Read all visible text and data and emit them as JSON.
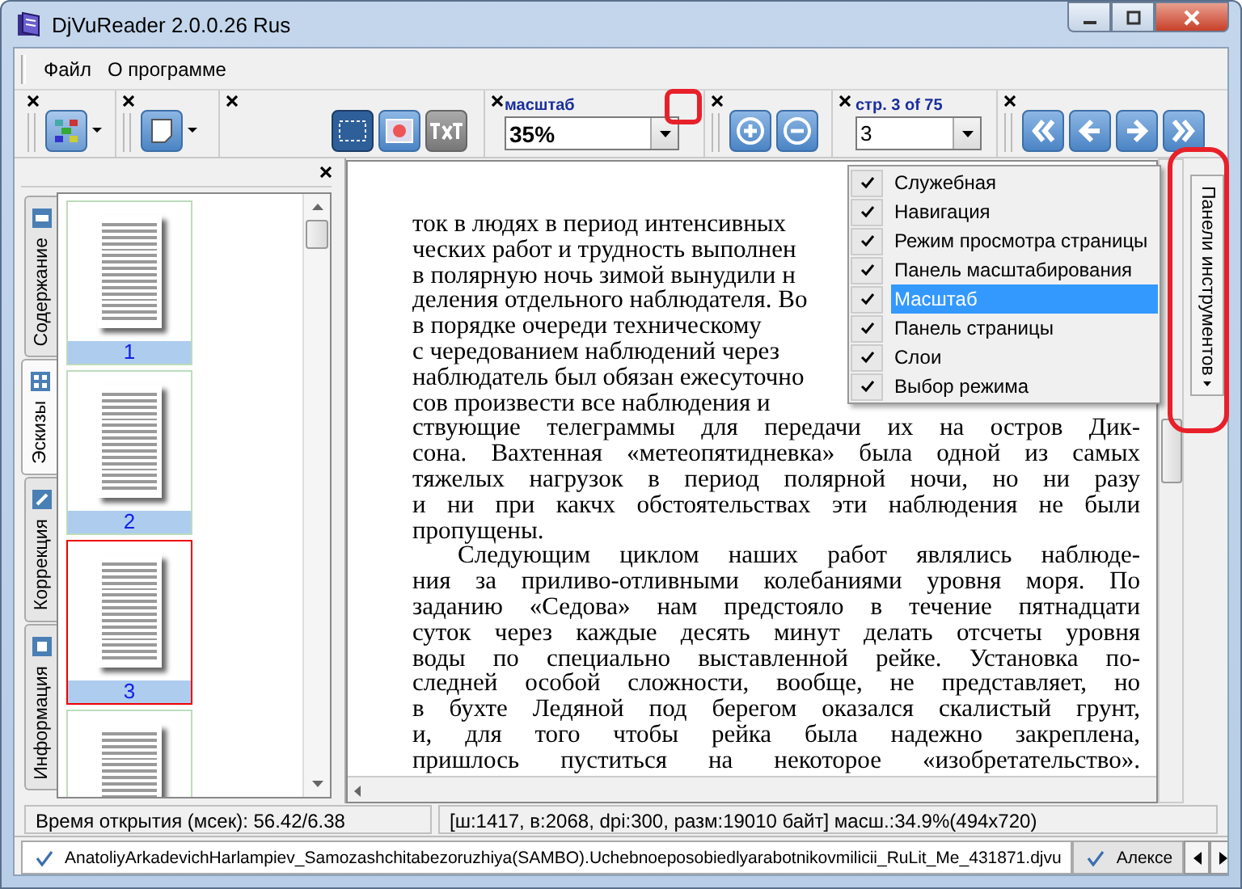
{
  "window": {
    "title": "DjVuReader 2.0.0.26 Rus"
  },
  "menu": [
    "Файл",
    "О программе"
  ],
  "toolbar": {
    "zoom": {
      "label": "масштаб",
      "value": "35%"
    },
    "page": {
      "label": "стр. 3 of 75",
      "value": "3"
    }
  },
  "sidebar": {
    "tabs": [
      {
        "label": "Содержание",
        "selected": false
      },
      {
        "label": "Эскизы",
        "selected": true
      },
      {
        "label": "Коррекция",
        "selected": false
      },
      {
        "label": "Информация",
        "selected": false
      }
    ],
    "thumbnails": [
      {
        "label": "1",
        "selected": false
      },
      {
        "label": "2",
        "selected": false
      },
      {
        "label": "3",
        "selected": true
      },
      {
        "selected": false
      }
    ]
  },
  "document": {
    "lines": [
      {
        "text": "ток в людях в период интенсивных",
        "full": false
      },
      {
        "text": "ческих работ и трудность выполнен",
        "full": false
      },
      {
        "text": "в полярную ночь зимой вынудили н",
        "full": false
      },
      {
        "text": "деления отдельного наблюдателя. Во",
        "full": false
      },
      {
        "text": "в порядке очереди техническому",
        "full": false
      },
      {
        "text": "с чередованием наблюдений через",
        "full": false
      },
      {
        "text": "наблюдатель был обязан ежесуточно",
        "full": false
      },
      {
        "text": "сов произвести все наблюдения и",
        "full": false
      },
      {
        "text": "ствующие телеграммы для передачи их на остров Дик-",
        "full": true
      },
      {
        "text": "сона. Вахтенная «метеопятидневка» была одной из самых",
        "full": true
      },
      {
        "text": "тяжелых нагрузок в период полярной ночи, но ни разу",
        "full": true
      },
      {
        "text": "и ни при какчх обстоятельствах эти наблюдения не были",
        "full": true
      },
      {
        "text": "пропущены.",
        "full": false
      },
      {
        "text": "Следующим циклом наших работ являлись наблюде-",
        "full": true,
        "indent": true
      },
      {
        "text": "ния за приливо-отливными колебаниями уровня моря. По",
        "full": true
      },
      {
        "text": "заданию «Седова» нам предстояло в течение пятнадцати",
        "full": true
      },
      {
        "text": "суток через каждые десять минут делать отсчеты уровня",
        "full": true
      },
      {
        "text": "воды по специально выставленной рейке. Установка по-",
        "full": true
      },
      {
        "text": "следней особой сложности, вообще, не представляет, но",
        "full": true
      },
      {
        "text": "в бухте Ледяной под берегом оказался скалистый грунт,",
        "full": true
      },
      {
        "text": "и, для того чтобы рейка была надежно закреплена,",
        "full": true
      },
      {
        "text": "пришлось пуститься на некоторое «изобретательство».",
        "full": true
      }
    ]
  },
  "popup_menu": {
    "items": [
      {
        "label": "Служебная",
        "checked": true,
        "selected": false
      },
      {
        "label": "Навигация",
        "checked": true,
        "selected": false
      },
      {
        "label": "Режим просмотра страницы",
        "checked": true,
        "selected": false
      },
      {
        "label": "Панель масштабирования",
        "checked": true,
        "selected": false
      },
      {
        "label": "Масштаб",
        "checked": true,
        "selected": true
      },
      {
        "label": "Панель страницы",
        "checked": true,
        "selected": false
      },
      {
        "label": "Слои",
        "checked": true,
        "selected": false
      },
      {
        "label": "Выбор режима",
        "checked": true,
        "selected": false
      }
    ]
  },
  "right_panel": {
    "label": "Панели инструментов"
  },
  "status_bar": [
    "Время открытия (мсек): 56.42/6.38",
    "[ш:1417, в:2068, dpi:300, разм:19010 байт] масш.:34.9%(494x720)"
  ],
  "document_tabs": [
    {
      "label": "AnatoliyArkadevichHarlampiev_Samozashchitabezoruzhiya(SAMBO).Uchebnoeposobiedlyarabotnikovmilicii_RuLit_Me_431871.djvu",
      "selected": true
    },
    {
      "label": "Алексе",
      "selected": false
    }
  ]
}
